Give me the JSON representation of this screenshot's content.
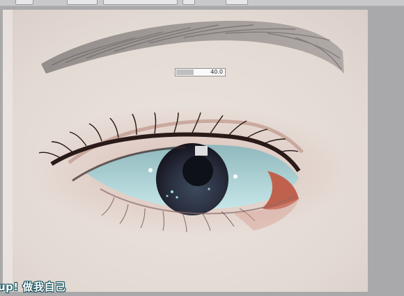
{
  "toolbar": {
    "buttons": [
      "toolbar-button-1",
      "toolbar-button-2",
      "toolbar-button-3",
      "toolbar-button-4",
      "toolbar-button-5"
    ]
  },
  "brush_size": {
    "value": "40.0",
    "fill_fraction": 0.36
  },
  "subtitle": {
    "text": "up! 做我自己"
  },
  "colors": {
    "workspace": "#a9a9ab",
    "canvas_skin": "#e6ddd7",
    "iris": "#8fc7cc",
    "caption_outline": "#0d4d57"
  }
}
